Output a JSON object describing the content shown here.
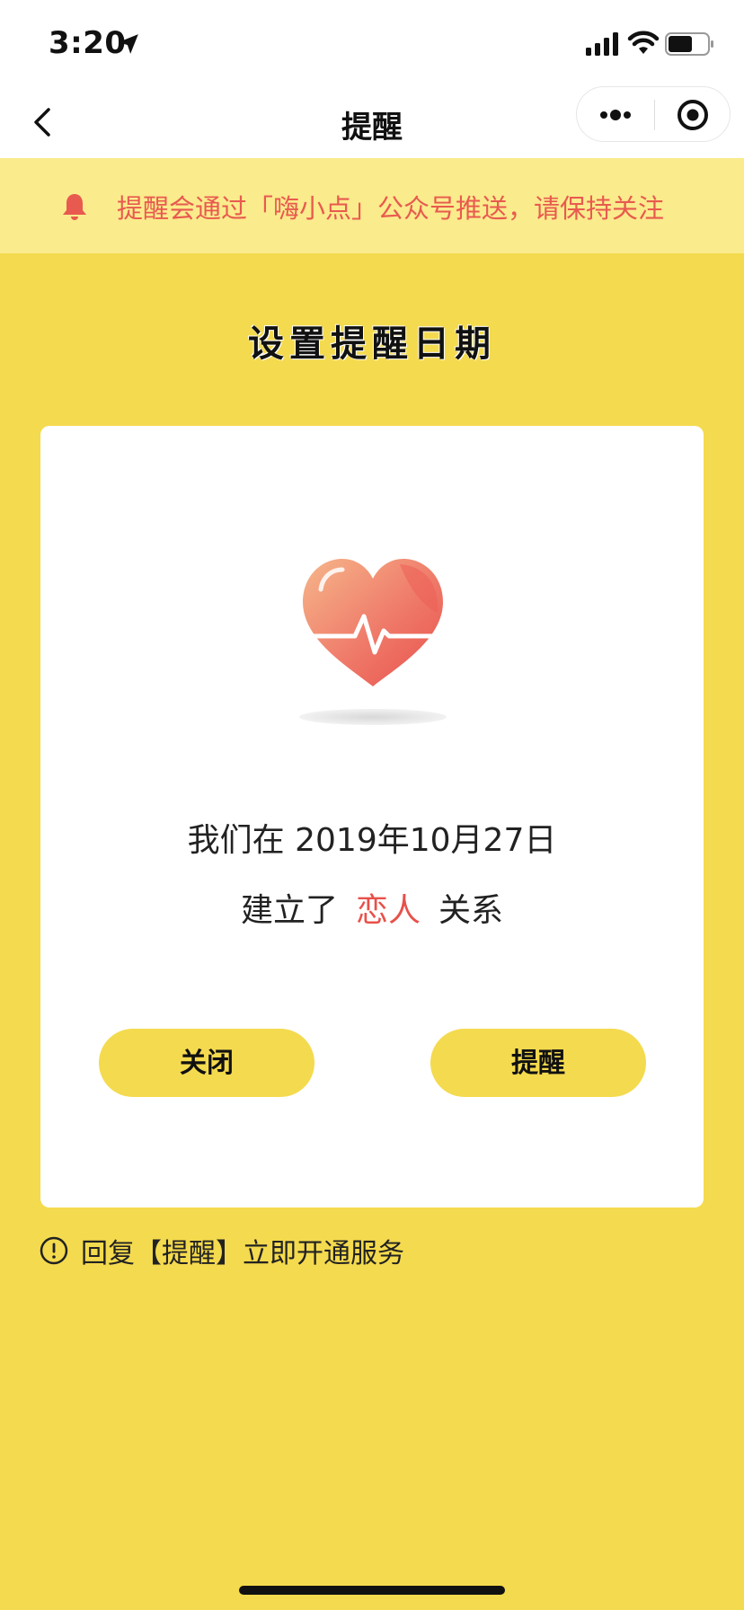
{
  "status_bar": {
    "time": "3:20"
  },
  "nav": {
    "title": "提醒"
  },
  "notice": {
    "text": "提醒会通过「嗨小点」公众号推送，请保持关注"
  },
  "page": {
    "section_title": "设置提醒日期"
  },
  "card": {
    "date_prefix": "我们在",
    "date": "2019年10月27日",
    "relation_prefix": "建立了",
    "relation": "恋人",
    "relation_suffix": "关系",
    "close_label": "关闭",
    "remind_label": "提醒"
  },
  "footer": {
    "tip": "回复【提醒】立即开通服务"
  },
  "colors": {
    "background": "#F4DA4E",
    "notice_bg": "#FAEB8C",
    "accent_red": "#E8504A",
    "notice_text": "#E85A4F"
  },
  "icons": [
    "location-arrow-icon",
    "signal-icon",
    "wifi-icon",
    "battery-icon",
    "back-icon",
    "more-icon",
    "close-capsule-icon",
    "bell-icon",
    "heart-pulse-icon",
    "info-icon"
  ]
}
